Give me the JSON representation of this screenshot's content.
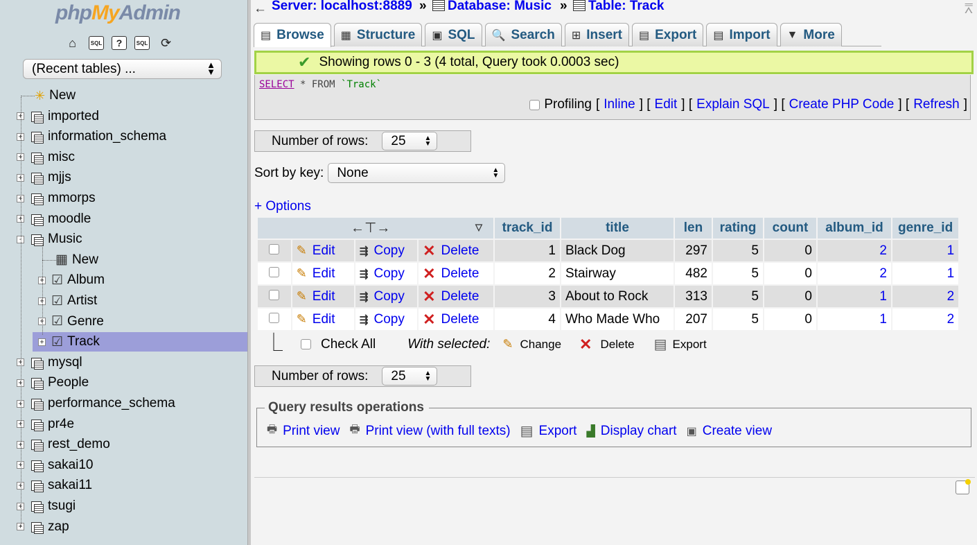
{
  "left": {
    "logo": {
      "php": "php",
      "my": "My",
      "admin": "Admin"
    },
    "icons": [
      "home-icon",
      "sql-icon",
      "help-icon",
      "docs-icon",
      "reload-icon"
    ],
    "recent_tables": "(Recent tables) ...",
    "tree": {
      "new_label": "New",
      "databases": [
        "imported",
        "information_schema",
        "misc",
        "mjjs",
        "mmorps",
        "moodle",
        "Music"
      ],
      "music_children": {
        "new_label": "New",
        "tables": [
          "Album",
          "Artist",
          "Genre",
          "Track"
        ]
      },
      "databases_after": [
        "mysql",
        "People",
        "performance_schema",
        "pr4e",
        "rest_demo",
        "sakai10",
        "sakai11",
        "tsugi",
        "zap"
      ],
      "selected": "Track"
    }
  },
  "breadcrumb": {
    "server": "Server: localhost:8889",
    "database": "Database: Music",
    "table": "Table: Track",
    "separator": "»"
  },
  "tabs": [
    {
      "label": "Browse",
      "icon": "browse-icon",
      "glyph": "▤",
      "active": true
    },
    {
      "label": "Structure",
      "icon": "structure-icon",
      "glyph": "▦"
    },
    {
      "label": "SQL",
      "icon": "sql-icon",
      "glyph": "▣"
    },
    {
      "label": "Search",
      "icon": "search-icon",
      "glyph": "🔍"
    },
    {
      "label": "Insert",
      "icon": "insert-icon",
      "glyph": "⊞"
    },
    {
      "label": "Export",
      "icon": "export-icon",
      "glyph": "▤"
    },
    {
      "label": "Import",
      "icon": "import-icon",
      "glyph": "▤"
    },
    {
      "label": "More",
      "icon": "chevron-down-icon",
      "glyph": "▼"
    }
  ],
  "message": "Showing rows 0 - 3 (4 total, Query took 0.0003 sec)",
  "query": {
    "select": "SELECT",
    "rest": " * FROM ",
    "table": "`Track`"
  },
  "profiling": {
    "label": "Profiling",
    "links": [
      "Inline",
      "Edit",
      "Explain SQL",
      "Create PHP Code",
      "Refresh"
    ]
  },
  "number_of_rows": {
    "label": "Number of rows:",
    "value": "25"
  },
  "sort_by_key": {
    "label": "Sort by key:",
    "value": "None"
  },
  "options_link": "+ Options",
  "table": {
    "columns": [
      "track_id",
      "title",
      "len",
      "rating",
      "count",
      "album_id",
      "genre_id"
    ],
    "row_actions": {
      "edit": "Edit",
      "copy": "Copy",
      "delete": "Delete"
    },
    "rows": [
      {
        "track_id": "1",
        "title": "Black Dog",
        "len": "297",
        "rating": "5",
        "count": "0",
        "album_id": "2",
        "genre_id": "1"
      },
      {
        "track_id": "2",
        "title": "Stairway",
        "len": "482",
        "rating": "5",
        "count": "0",
        "album_id": "2",
        "genre_id": "1"
      },
      {
        "track_id": "3",
        "title": "About to Rock",
        "len": "313",
        "rating": "5",
        "count": "0",
        "album_id": "1",
        "genre_id": "2"
      },
      {
        "track_id": "4",
        "title": "Who Made Who",
        "len": "207",
        "rating": "5",
        "count": "0",
        "album_id": "1",
        "genre_id": "2"
      }
    ]
  },
  "bulk": {
    "check_all": "Check All",
    "with_selected": "With selected:",
    "change": "Change",
    "delete": "Delete",
    "export": "Export"
  },
  "qro": {
    "legend": "Query results operations",
    "print_view": "Print view",
    "print_view_full": "Print view (with full texts)",
    "export": "Export",
    "display_chart": "Display chart",
    "create_view": "Create view"
  },
  "colors": {
    "link": "#235a81",
    "success_bg": "#ebf8a4",
    "success_border": "#a2d246",
    "selected_nav": "#9c9ed9"
  }
}
